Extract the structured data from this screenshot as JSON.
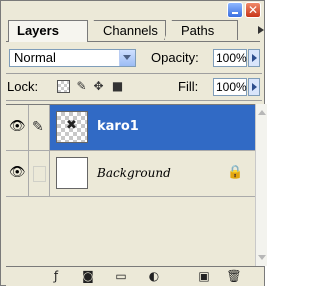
{
  "tabs": [
    {
      "label": "Layers",
      "active": true
    },
    {
      "label": "Channels",
      "active": false
    },
    {
      "label": "Paths",
      "active": false
    }
  ],
  "blend_mode": "Normal",
  "opacity": {
    "label": "Opacity:",
    "value": "100%"
  },
  "lock": {
    "label": "Lock:"
  },
  "fill": {
    "label": "Fill:",
    "value": "100%"
  },
  "layers": [
    {
      "name": "karo1",
      "selected": true,
      "visible": true,
      "locked": false
    },
    {
      "name": "Background",
      "selected": false,
      "visible": true,
      "locked": true
    }
  ],
  "colors": {
    "selection": "#316ac5",
    "panel_bg": "#ece9d8"
  },
  "icons": {
    "eye": "eye-icon",
    "brush": "brush-icon",
    "lock": "lock-icon",
    "bottom": [
      "link-layers-icon",
      "add-style-icon",
      "add-mask-icon",
      "new-group-icon",
      "new-adjustment-icon",
      "new-layer-icon",
      "delete-layer-icon"
    ]
  }
}
